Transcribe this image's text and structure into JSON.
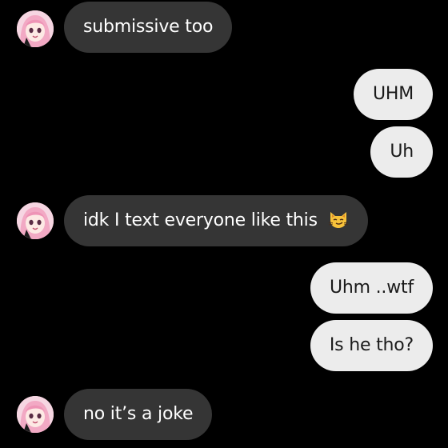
{
  "chat": {
    "messages": [
      {
        "sender": "them",
        "text": "submissive too",
        "avatar_icon": "avatar-pink-hair-girl"
      },
      {
        "sender": "me",
        "text": "UHM"
      },
      {
        "sender": "me",
        "text": "Uh"
      },
      {
        "sender": "them",
        "text": "idk I text everyone like this",
        "emoji": "smirking-cat-emoji",
        "avatar_icon": "avatar-pink-hair-girl"
      },
      {
        "sender": "me",
        "text": "Uhm ..wtf"
      },
      {
        "sender": "me",
        "text": "Is he tho?"
      },
      {
        "sender": "them",
        "text": "no it’s a joke",
        "avatar_icon": "avatar-pink-hair-girl"
      }
    ]
  },
  "colors": {
    "background": "#000000",
    "incoming_bubble": "#353535",
    "outgoing_bubble": "#ececec",
    "avatar_hair": "#f2a9c4"
  }
}
